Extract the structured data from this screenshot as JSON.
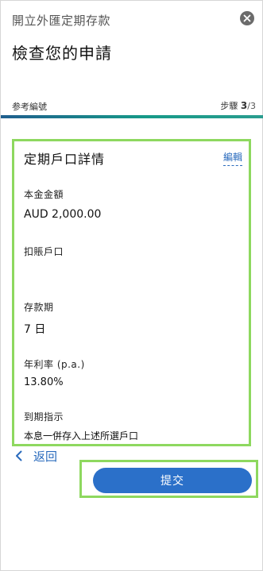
{
  "header": {
    "app_title": "開立外匯定期存款",
    "page_title": "檢查您的申請"
  },
  "progress": {
    "reference_label": "参考編號",
    "step_label": "步驟",
    "step_current": "3",
    "step_total": "/3",
    "fraction_complete": 1.0,
    "colors": {
      "start": "#1f5e8e",
      "end": "#2a9d8f",
      "track": "#e4e4e4"
    }
  },
  "details": {
    "title": "定期戶口詳情",
    "edit_label": "編輯",
    "fields": [
      {
        "label": "本金金額",
        "value": "AUD 2,000.00"
      },
      {
        "label": "扣賬戶口",
        "value": ""
      },
      {
        "label": "存款期",
        "value": "7 日"
      },
      {
        "label": "年利率 (p.a.)",
        "value": "13.80%"
      },
      {
        "label": "到期指示",
        "value": "本息一併存入上述所選戶口"
      }
    ]
  },
  "footer": {
    "back_label": "返回",
    "submit_label": "提交"
  },
  "icons": {
    "close": "close-icon",
    "back": "chevron-left-icon"
  },
  "colors": {
    "accent_blue": "#2b70c9",
    "link_blue": "#2a6bbd",
    "highlight_green": "#8ed85f"
  }
}
